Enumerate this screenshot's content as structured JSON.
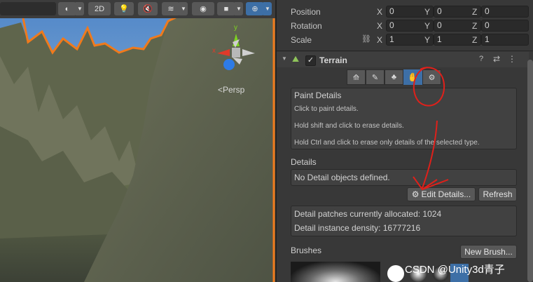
{
  "scene": {
    "persp_label": "<Persp",
    "toolbar": {
      "mode_2d": "2D"
    },
    "gizmo": {
      "y_label": "y",
      "x_label": "x"
    }
  },
  "transform": {
    "position": {
      "label": "Position",
      "x": "0",
      "y": "0",
      "z": "0"
    },
    "rotation": {
      "label": "Rotation",
      "x": "0",
      "y": "0",
      "z": "0"
    },
    "scale": {
      "label": "Scale",
      "x": "1",
      "y": "1",
      "z": "1"
    },
    "axes": {
      "x": "X",
      "y": "Y",
      "z": "Z"
    }
  },
  "terrain": {
    "title": "Terrain",
    "paint_details": {
      "title": "Paint Details",
      "line1": "Click to paint details.",
      "line2": "Hold shift and click to erase details.",
      "line3": "Hold Ctrl and click to erase only details of the selected type."
    },
    "details": {
      "heading": "Details",
      "empty_message": "No Detail objects defined.",
      "edit_button": "Edit Details...",
      "refresh_button": "Refresh",
      "patches": "Detail patches currently allocated: 1024",
      "density": "Detail instance density: 16777216"
    },
    "brushes": {
      "heading": "Brushes",
      "new_button": "New Brush..."
    }
  },
  "watermark": "CSDN @Unity3d青子",
  "colors": {
    "selection_outline": "#f07a1c",
    "annotation_red": "#e0201a",
    "active_tool": "#3d6fa6"
  }
}
